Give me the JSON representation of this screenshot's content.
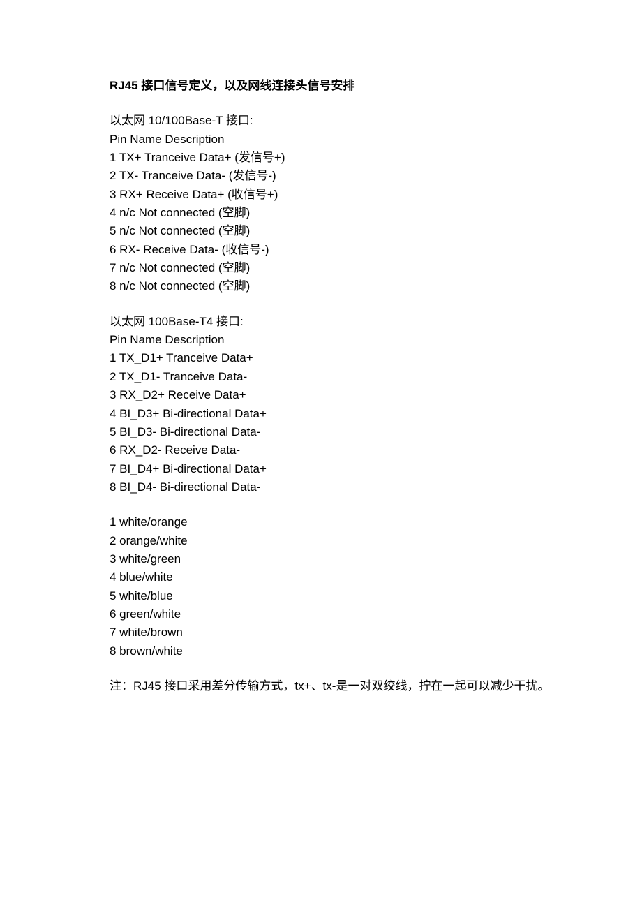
{
  "title": "RJ45 接口信号定义，以及网线连接头信号安排",
  "section1": {
    "header": "以太网 10/100Base-T 接口:",
    "subheader": "Pin Name Description",
    "pins": [
      "1 TX+ Tranceive Data+ (发信号+)",
      "2 TX- Tranceive Data- (发信号-)",
      "3 RX+ Receive Data+ (收信号+)",
      "4 n/c Not connected (空脚)",
      "5 n/c Not connected (空脚)",
      "6 RX- Receive Data- (收信号-)",
      "7 n/c Not connected (空脚)",
      "8 n/c Not connected (空脚)"
    ]
  },
  "section2": {
    "header": "以太网 100Base-T4 接口:",
    "subheader": "Pin Name Description",
    "pins": [
      "1 TX_D1+ Tranceive Data+",
      "2 TX_D1- Tranceive Data-",
      "3 RX_D2+ Receive Data+",
      "4 BI_D3+ Bi-directional Data+",
      "5 BI_D3- Bi-directional Data-",
      "6 RX_D2- Receive Data-",
      "7 BI_D4+ Bi-directional Data+",
      "8 BI_D4- Bi-directional Data-"
    ]
  },
  "section3": {
    "colors": [
      "1 white/orange",
      "2 orange/white",
      "3 white/green",
      "4 blue/white",
      "5 white/blue",
      "6 green/white",
      "7 white/brown",
      "8 brown/white"
    ]
  },
  "note": "注：RJ45 接口采用差分传输方式，tx+、tx-是一对双绞线，拧在一起可以减少干扰。"
}
